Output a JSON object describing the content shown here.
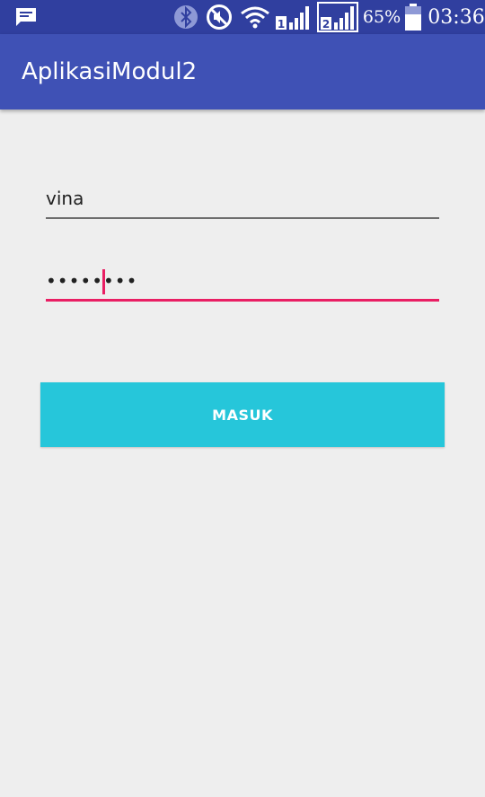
{
  "status_bar": {
    "battery_percent": "65%",
    "time": "03:36",
    "sim1_label": "1",
    "sim2_label": "2",
    "icons": [
      "message-icon",
      "bluetooth-icon",
      "mute-icon",
      "wifi-icon",
      "signal-sim1-icon",
      "signal-sim2-icon",
      "battery-icon"
    ]
  },
  "app_bar": {
    "title": "AplikasiModul2"
  },
  "form": {
    "username_value": "vina",
    "password_value": "••••••••",
    "accent_color": "#e91e63"
  },
  "login_button": {
    "label": "MASUK",
    "color": "#26c6da"
  },
  "colors": {
    "status_bar": "#303f9f",
    "app_bar": "#3f51b5",
    "background": "#eeeeee"
  }
}
